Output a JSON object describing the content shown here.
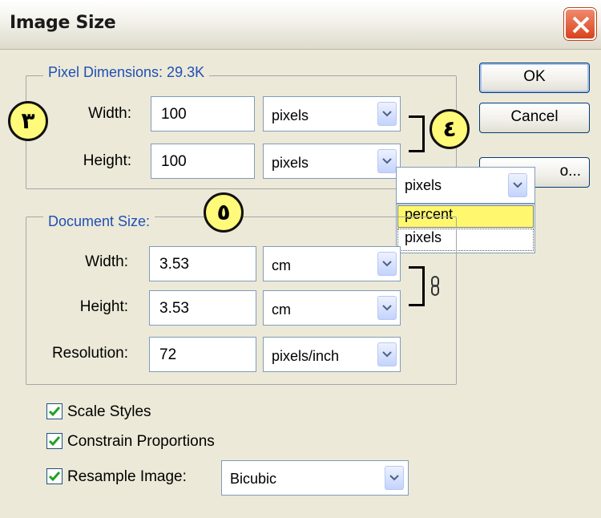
{
  "window": {
    "title": "Image Size"
  },
  "pixel_dimensions": {
    "legend": "Pixel Dimensions:  29.3K",
    "width_label": "Width:",
    "width_value": "100",
    "width_unit": "pixels",
    "height_label": "Height:",
    "height_value": "100",
    "height_unit": "pixels"
  },
  "document_size": {
    "legend": "Document Size:",
    "width_label": "Width:",
    "width_value": "3.53",
    "width_unit": "cm",
    "height_label": "Height:",
    "height_value": "3.53",
    "height_unit": "cm",
    "resolution_label": "Resolution:",
    "resolution_value": "72",
    "resolution_unit": "pixels/inch"
  },
  "buttons": {
    "ok": "OK",
    "cancel": "Cancel",
    "auto": "o..."
  },
  "unit_dropdown": {
    "selected": "pixels",
    "options": [
      "percent",
      "pixels"
    ],
    "highlighted": "percent"
  },
  "options": {
    "scale_styles": {
      "label": "Scale Styles",
      "checked": true
    },
    "constrain_proportions": {
      "label": "Constrain Proportions",
      "checked": true
    },
    "resample_image": {
      "label": "Resample Image:",
      "checked": true,
      "method": "Bicubic"
    }
  },
  "annotations": [
    "٣",
    "٤",
    "٥"
  ],
  "colors": {
    "dialog_bg": "#ece9d8",
    "legend_text": "#1f4fb5",
    "badge_fill": "#fffa7a",
    "highlight": "#fff86e",
    "close_button": "#d8431c"
  }
}
